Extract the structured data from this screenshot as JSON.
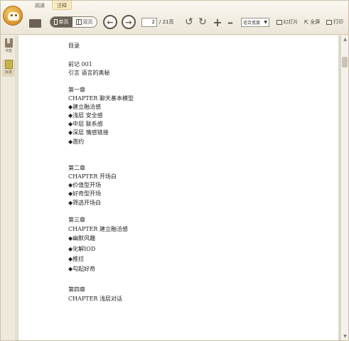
{
  "menu": {
    "tabs": [
      "阅读",
      "注释"
    ],
    "active_tab": "注释"
  },
  "toolbar": {
    "single_page": "单页",
    "double_page": "双页",
    "page_current": "2",
    "page_total": "/ 21页",
    "fit_mode": "适合宽度",
    "slideshow": "幻灯片",
    "fullscreen": "全屏",
    "print": "打印"
  },
  "sidebar": {
    "bookmark": "书签",
    "toc": "目录"
  },
  "document": {
    "lines": [
      "目录",
      "前记 001",
      "引言 语言的奥秘",
      "第一章",
      "CHAPTER 聊天基本模型",
      "◆建立融洽感",
      "◆浅层 安全感",
      "◆中层 联系感",
      "◆深层 情感链接",
      "◆邀约",
      "第二章",
      "CHAPTER 开场白",
      "◆价值型开场",
      "◆好奇型开场",
      "◆筛选开场白",
      "第三章",
      "CHAPTER 建立融洽感",
      "◆幽默风趣",
      "◆化解IOD",
      "◆推拉",
      "◆勾起好奇",
      "第四章",
      "CHAPTER 浅层对话"
    ]
  },
  "colors": {
    "accent": "#d9962a",
    "toolbar_bg": "#ece6d8",
    "page_bg": "#ffffff"
  }
}
